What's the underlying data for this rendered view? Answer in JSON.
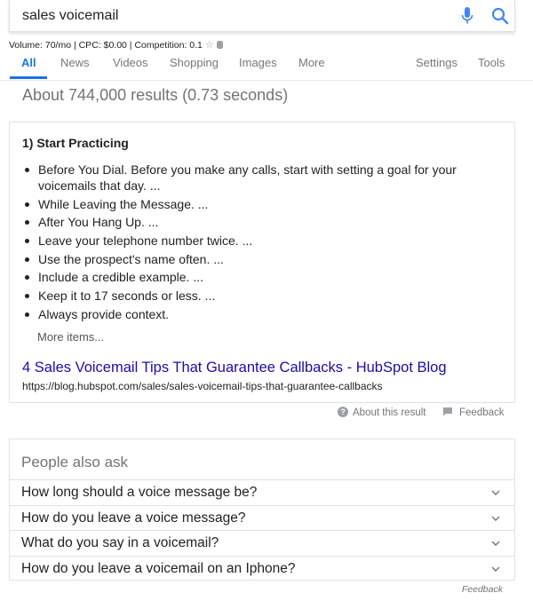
{
  "search": {
    "query": "sales voicemail"
  },
  "keyword_info": "Volume: 70/mo | CPC: $0.00 | Competition: 0.1",
  "tabs": [
    {
      "label": "All"
    },
    {
      "label": "News"
    },
    {
      "label": "Videos"
    },
    {
      "label": "Shopping"
    },
    {
      "label": "Images"
    },
    {
      "label": "More"
    },
    {
      "label": "Settings"
    },
    {
      "label": "Tools"
    }
  ],
  "results_stats": "About 744,000 results (0.73 seconds)",
  "featured_snippet": {
    "heading": "1) Start Practicing",
    "items": [
      "Before You Dial. Before you make any calls, start with setting a goal for your voicemails that day. ...",
      "While Leaving the Message. ...",
      "After You Hang Up. ...",
      "Leave your telephone number twice. ...",
      "Use the prospect's name often. ...",
      "Include a credible example. ...",
      "Keep it to 17 seconds or less. ...",
      "Always provide context."
    ],
    "more_items": "More items...",
    "result_title": "4 Sales Voicemail Tips That Guarantee Callbacks - HubSpot Blog",
    "result_url": "https://blog.hubspot.com/sales/sales-voicemail-tips-that-guarantee-callbacks"
  },
  "snippet_footer": {
    "about": "About this result",
    "feedback": "Feedback"
  },
  "people_also_ask": {
    "title": "People also ask",
    "questions": [
      "How long should a voice message be?",
      "How do you leave a voice message?",
      "What do you say in a voicemail?",
      "How do you leave a voicemail on an Iphone?"
    ]
  },
  "footer_feedback": "Feedback",
  "colors": {
    "accent": "#1a73e8",
    "link": "#1a0dab",
    "muted": "#70757a"
  }
}
